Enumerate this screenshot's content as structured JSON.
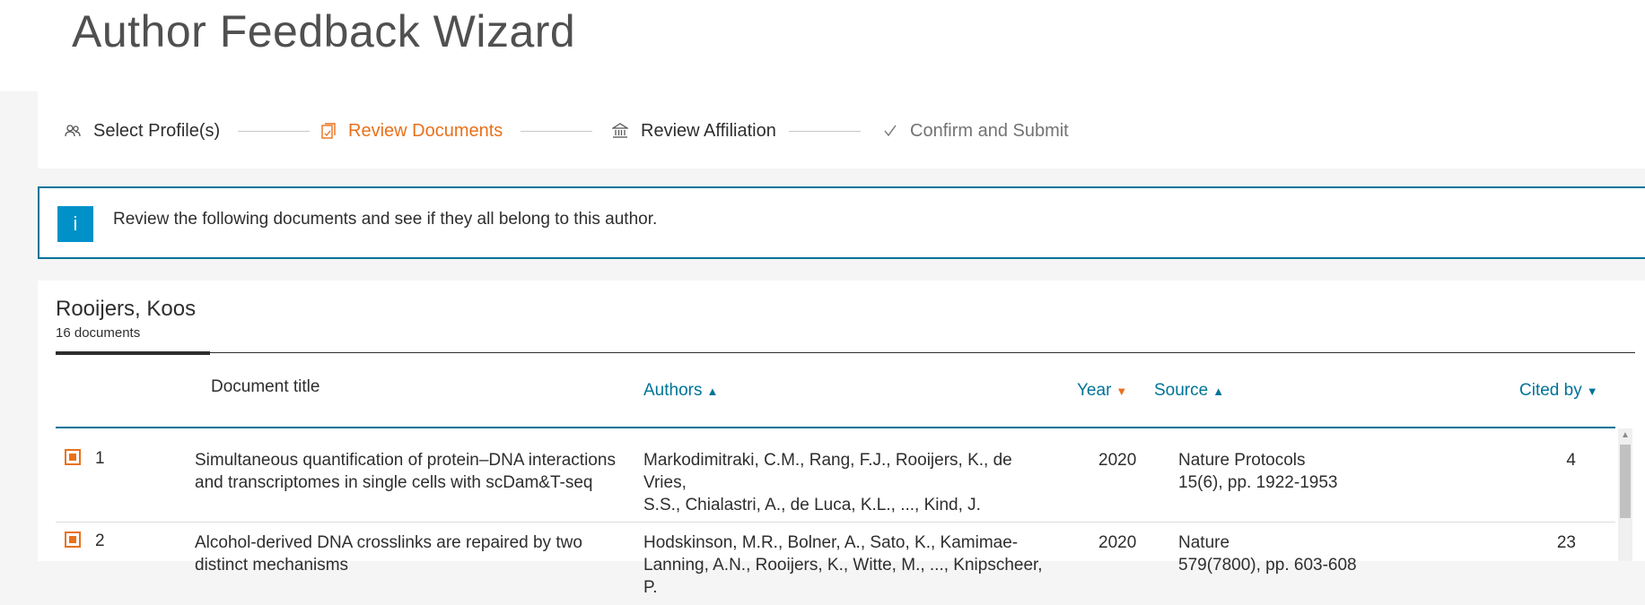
{
  "page": {
    "title": "Author Feedback Wizard"
  },
  "steps": [
    {
      "label": "Select Profile(s)",
      "icon": "people-icon",
      "state": "done"
    },
    {
      "label": "Review Documents",
      "icon": "document-icon",
      "state": "active"
    },
    {
      "label": "Review Affiliation",
      "icon": "institution-icon",
      "state": "done"
    },
    {
      "label": "Confirm and Submit",
      "icon": "checkmark-icon",
      "state": "todo"
    }
  ],
  "info": {
    "icon_letter": "i",
    "text": "Review the following documents and see if they all belong to this author."
  },
  "author": {
    "name": "Rooijers, Koos",
    "doc_count": "16 documents"
  },
  "table": {
    "headers": {
      "title": "Document title",
      "authors": "Authors",
      "year": "Year",
      "source": "Source",
      "cited": "Cited by"
    },
    "rows": [
      {
        "num": "1",
        "title_line1": "Simultaneous quantification of protein–DNA interactions",
        "title_line2": "and transcriptomes in single cells with scDam&T-seq",
        "authors_line1": "Markodimitraki, C.M., Rang, F.J., Rooijers, K., de Vries,",
        "authors_line2": "S.S., Chialastri, A., de Luca, K.L., ..., Kind, J.",
        "year": "2020",
        "source_line1": "Nature Protocols",
        "source_line2": "15(6), pp. 1922-1953",
        "cited": "4",
        "checked": true
      },
      {
        "num": "2",
        "title_line1": "Alcohol-derived DNA crosslinks are repaired by two",
        "title_line2": "distinct mechanisms",
        "authors_line1": "Hodskinson, M.R., Bolner, A., Sato, K., Kamimae-",
        "authors_line2": "Lanning, A.N., Rooijers, K., Witte, M., ..., Knipscheer, P.",
        "year": "2020",
        "source_line1": "Nature",
        "source_line2": "579(7800), pp. 603-608",
        "cited": "23",
        "checked": true
      }
    ]
  },
  "colors": {
    "accent_orange": "#e9711c",
    "link_blue": "#007398",
    "info_blue": "#0091c9"
  }
}
